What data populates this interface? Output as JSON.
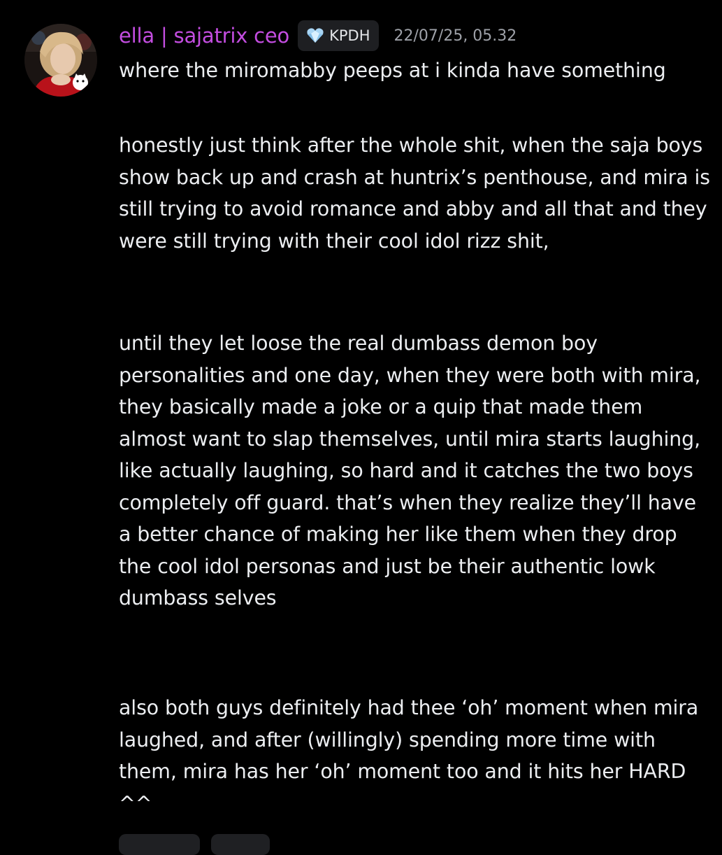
{
  "message": {
    "author": "ella | sajatrix ceo",
    "guild_tag": {
      "icon": "heart-gem-icon",
      "label": "KPDH"
    },
    "timestamp": "22/07/25, 05.32",
    "paragraphs": [
      "where the miromabby peeps at i kinda have something",
      "honestly just think after the whole shit, when the saja boys show back up and crash at huntrix’s penthouse, and mira is still trying to avoid romance and abby and all that and they were still trying with their cool idol rizz shit,",
      "until they let loose the real dumbass demon boy personalities and one day, when they were both with mira, they basically made a joke or a quip that made them almost want to slap themselves, until mira starts laughing, like actually laughing, so hard and it catches the two boys completely off guard. that’s when they realize they’ll have a better chance of making her like them when they drop the cool idol personas and just be their authentic lowk dumbass selves",
      "also both guys definitely had thee ‘oh’ moment when mira laughed, and after (willingly) spending more time with them, mira has her ‘oh’ moment too and it hits her HARD ^^"
    ]
  },
  "colors": {
    "background": "#000000",
    "username": "#c34de0",
    "text": "#eceef1",
    "timestamp": "#9ea1a8",
    "badge_bg": "#1e1f22"
  }
}
